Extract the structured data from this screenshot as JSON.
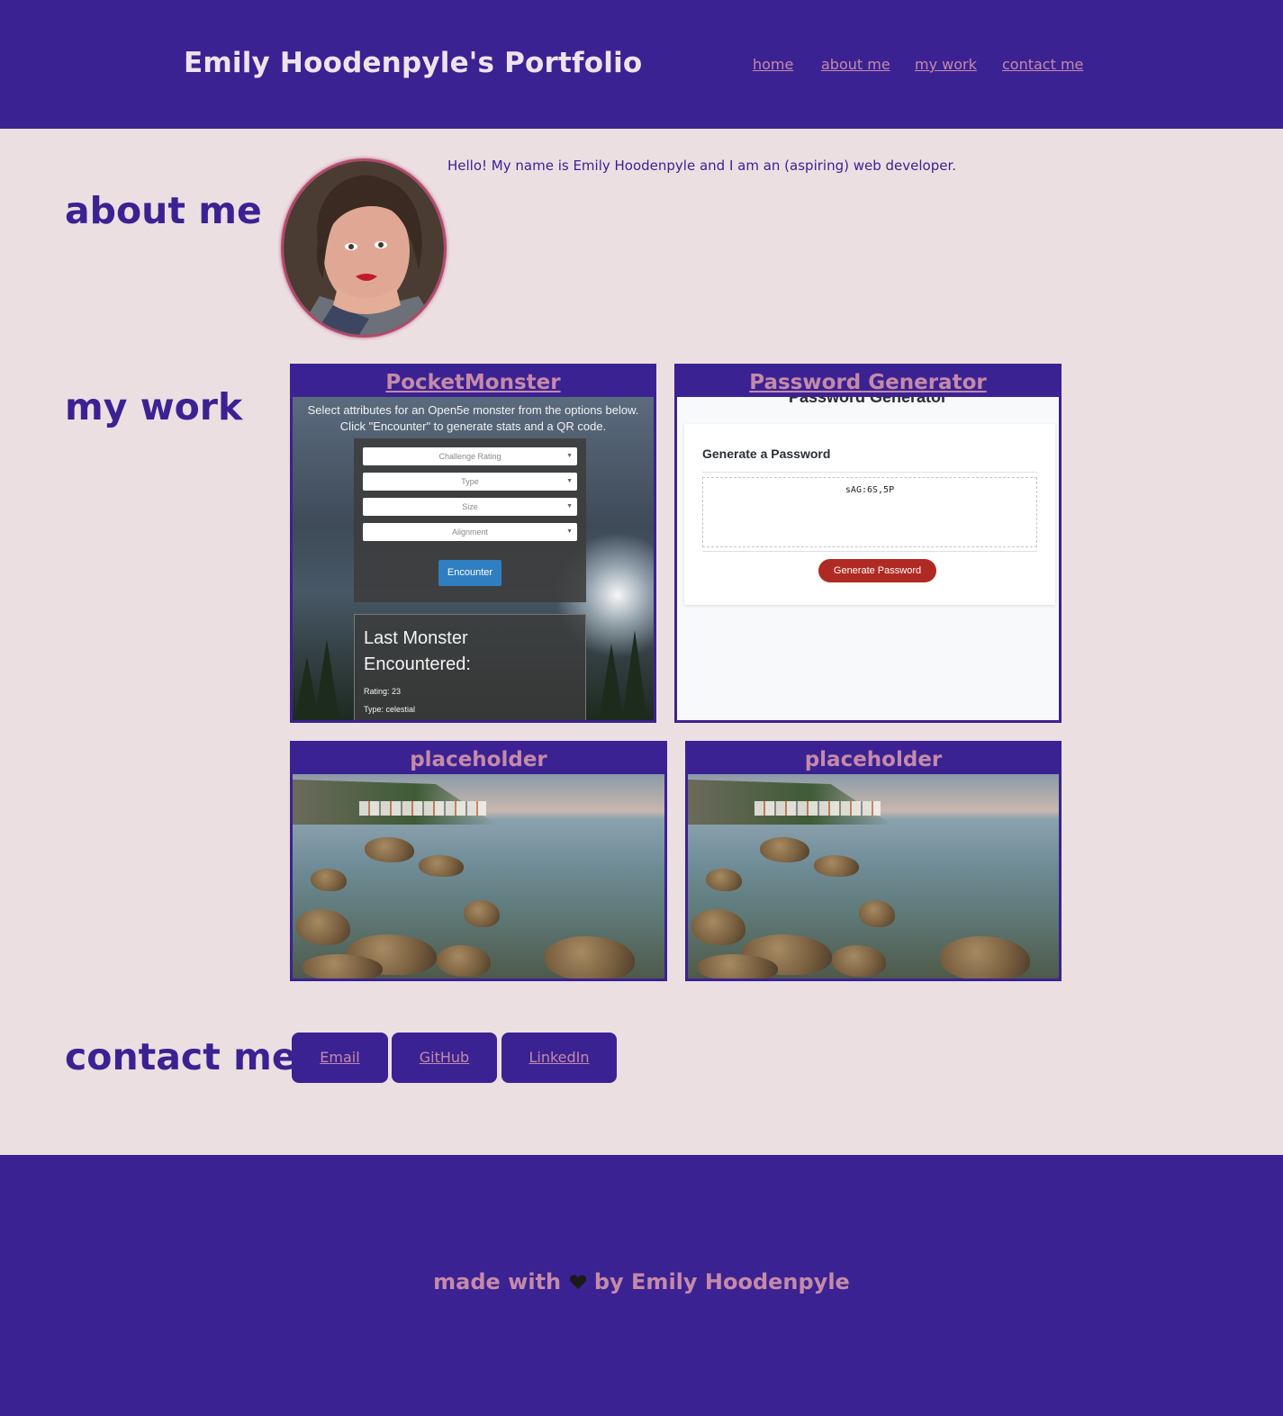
{
  "header": {
    "title": "Emily Hoodenpyle's Portfolio",
    "nav": [
      "home",
      "about me",
      "my work",
      "contact me"
    ]
  },
  "about": {
    "heading": "about me",
    "intro": "Hello! My name is Emily Hoodenpyle and I am an (aspiring) web developer.",
    "avatar_icon": "profile-photo"
  },
  "work": {
    "heading": "my work",
    "projects": [
      {
        "title": "PocketMonster",
        "screenshot": {
          "intro_line1": "Select attributes for an Open5e monster from the options below.",
          "intro_line2": "Click \"Encounter\" to generate stats and a QR code.",
          "selects": [
            "Challenge Rating",
            "Type",
            "Size",
            "Alignment"
          ],
          "button": "Encounter",
          "last_title": "Last Monster Encountered:",
          "stats": [
            "Rating: 23",
            "Type: celestial"
          ]
        }
      },
      {
        "title": "Password Generator",
        "screenshot": {
          "heading": "Password Generator",
          "card_title": "Generate a Password",
          "password": "sAG:6S,5P",
          "button": "Generate Password"
        }
      },
      {
        "title": "placeholder"
      },
      {
        "title": "placeholder"
      }
    ]
  },
  "contact": {
    "heading": "contact me",
    "links": [
      "Email",
      "GitHub",
      "LinkedIn"
    ]
  },
  "footer": {
    "text_before": "made with",
    "heart_icon": "black-heart",
    "text_after": "by Emily Hoodenpyle"
  },
  "colors": {
    "primary": "#3b2292",
    "background": "#ecdfe2",
    "accent": "#c48aa8",
    "title_text": "#efe3ea"
  }
}
